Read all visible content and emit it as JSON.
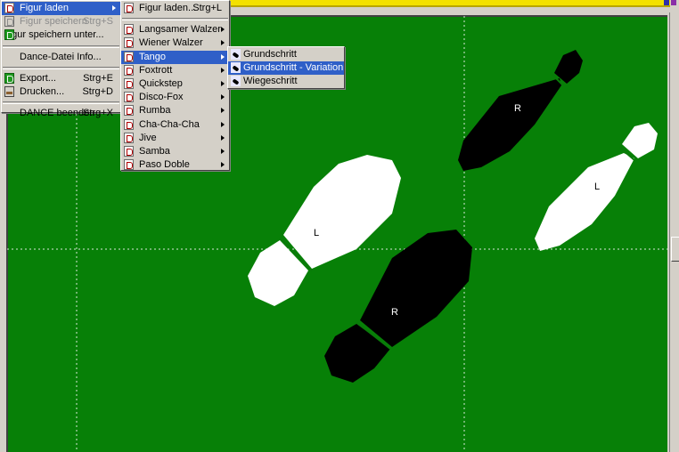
{
  "file_menu": {
    "items": [
      {
        "label": "Figur laden",
        "accel": "",
        "has_submenu": true,
        "state": "selected",
        "icon": "folder-open-icon"
      },
      {
        "label": "Figur speichern",
        "accel": "Strg+S",
        "state": "disabled",
        "icon": "save-icon"
      },
      {
        "label": "Figur speichern unter...",
        "accel": "",
        "state": "normal",
        "icon": "save-as-icon"
      },
      {
        "label": "Dance-Datei Info...",
        "accel": "",
        "state": "normal",
        "icon": ""
      },
      {
        "label": "Export...",
        "accel": "Strg+E",
        "state": "normal",
        "icon": "export-icon"
      },
      {
        "label": "Drucken...",
        "accel": "Strg+D",
        "state": "normal",
        "icon": "print-icon"
      },
      {
        "label": "DANCE beenden",
        "accel": "Strg+X",
        "state": "normal",
        "icon": ""
      }
    ]
  },
  "figur_menu": {
    "items": [
      {
        "label": "Figur laden...",
        "accel": "Strg+L"
      },
      {
        "label": "Langsamer Walzer"
      },
      {
        "label": "Wiener Walzer"
      },
      {
        "label": "Tango"
      },
      {
        "label": "Foxtrott"
      },
      {
        "label": "Quickstep"
      },
      {
        "label": "Disco-Fox"
      },
      {
        "label": "Rumba"
      },
      {
        "label": "Cha-Cha-Cha"
      },
      {
        "label": "Jive"
      },
      {
        "label": "Samba"
      },
      {
        "label": "Paso Doble"
      }
    ]
  },
  "tango_menu": {
    "items": [
      {
        "label": "Grundschritt"
      },
      {
        "label": "Grundschritt - Variation"
      },
      {
        "label": "Wiegeschritt"
      }
    ]
  },
  "canvas": {
    "background": "#078007",
    "footprints": [
      {
        "label": "R",
        "color": "black"
      },
      {
        "label": "L",
        "color": "white"
      },
      {
        "label": "L",
        "color": "white"
      },
      {
        "label": "R",
        "color": "black"
      }
    ]
  }
}
